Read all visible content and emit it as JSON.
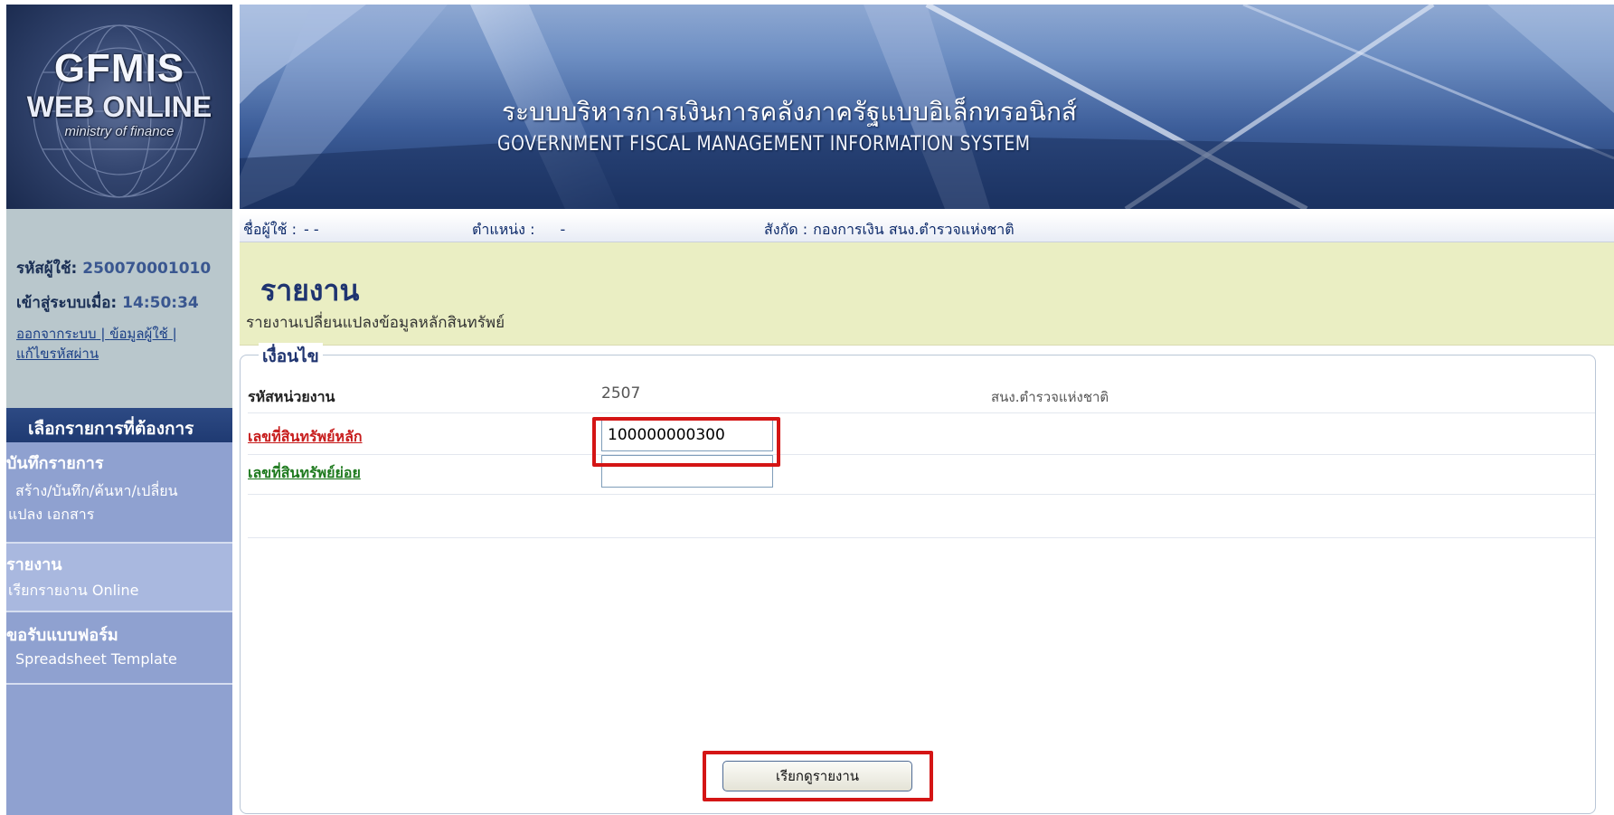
{
  "logo": {
    "line1": "GFMIS",
    "line2": "WEB ONLINE",
    "line3": "ministry of finance"
  },
  "header": {
    "title_th": "ระบบบริหารการเงินการคลังภาครัฐแบบอิเล็กทรอนิกส์",
    "title_en": "GOVERNMENT FISCAL MANAGEMENT INFORMATION SYSTEM"
  },
  "info_bar": {
    "username_label": "ชื่อผู้ใช้ :",
    "username_value": "- -",
    "position_label": "ตำแหน่ง :",
    "position_value": "-",
    "affiliation_label": "สังกัด :",
    "affiliation_value": "กองการเงิน สนง.ตำรวจแห่งชาติ"
  },
  "sidebar": {
    "user_id_label": "รหัสผู้ใช้:",
    "user_id_value": "250070001010",
    "login_time_label": "เข้าสู่ระบบเมื่อ:",
    "login_time_value": "14:50:34",
    "links": [
      "ออกจากระบบ",
      "ข้อมูลผู้ใช้",
      "แก้ไขรหัสผ่าน"
    ],
    "menu_header": "เลือกรายการที่ต้องการ",
    "menu": [
      {
        "title": "บันทึกรายการ",
        "sub1": "สร้าง/บันทึก/ค้นหา/เปลี่ยน",
        "sub2": "แปลง เอกสาร"
      },
      {
        "title": "รายงาน",
        "sub1": "เรียกรายงาน Online"
      },
      {
        "title": "ขอรับแบบฟอร์ม",
        "sub1": "Spreadsheet Template"
      }
    ]
  },
  "main": {
    "title": "รายงาน",
    "subtitle": "รายงานเปลี่ยนแปลงข้อมูลหลักสินทรัพย์",
    "condition_legend": "เงื่อนไข",
    "fields": {
      "unit_code_label": "รหัสหน่วยงาน",
      "unit_code_value": "2507",
      "unit_name": "สนง.ตำรวจแห่งชาติ",
      "main_asset_label": "เลขที่สินทรัพย์หลัก",
      "main_asset_value": "100000000300",
      "sub_asset_label": "เลขที่สินทรัพย์ย่อย",
      "sub_asset_value": ""
    },
    "view_button": "เรียกดูรายงาน"
  },
  "colors": {
    "highlight": "#d41515",
    "title_block_bg": "#eaeec3",
    "menu_header_bg": "#1f3a72",
    "required_label": "#c71c1c",
    "optional_label": "#1e7a1e"
  }
}
